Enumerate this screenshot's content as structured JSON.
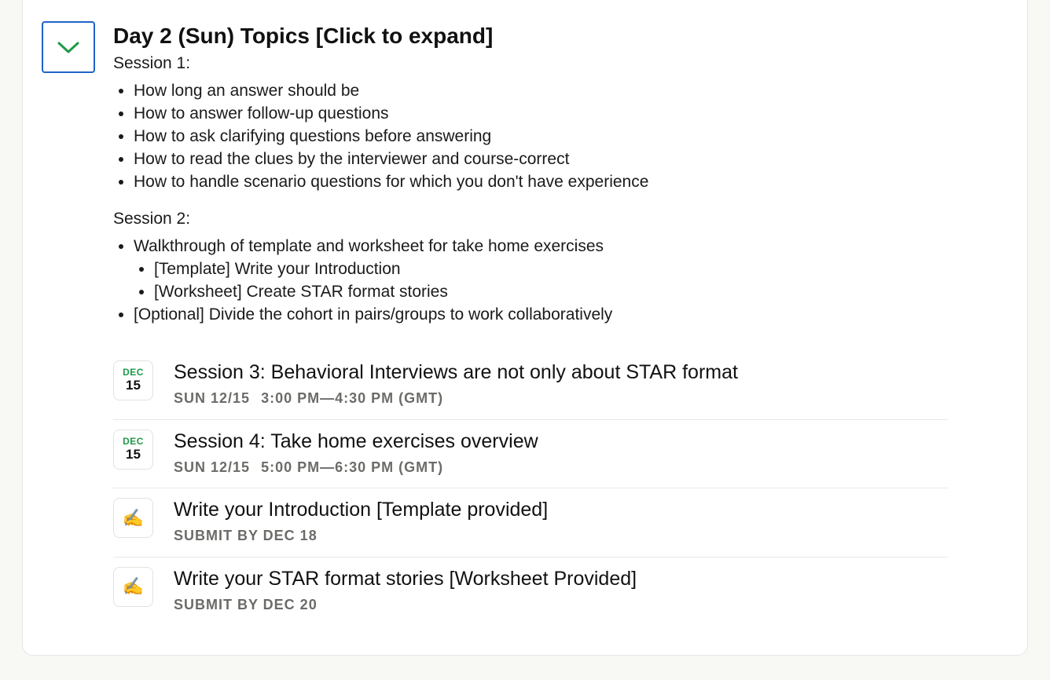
{
  "topic": {
    "title": "Day 2 (Sun) Topics [Click to expand]",
    "session1": {
      "label": "Session 1:",
      "items": [
        "How long an answer should be",
        "How to answer follow-up questions",
        "How to ask clarifying questions before answering",
        "How to read the clues by the interviewer and course-correct",
        "How to handle scenario questions for which you don't have experience"
      ]
    },
    "session2": {
      "label": "Session 2:",
      "items": [
        "Walkthrough of template and worksheet for take home exercises",
        "[Template] Write your Introduction",
        "[Worksheet] Create STAR format stories",
        "[Optional] Divide the cohort in pairs/groups to work collaboratively"
      ]
    }
  },
  "events": [
    {
      "month": "DEC",
      "day": "15",
      "title": "Session 3: Behavioral Interviews are not only about STAR format",
      "date": "SUN 12/15",
      "time": "3:00 PM—4:30 PM (GMT)"
    },
    {
      "month": "DEC",
      "day": "15",
      "title": "Session 4: Take home exercises overview",
      "date": "SUN 12/15",
      "time": "5:00 PM—6:30 PM (GMT)"
    },
    {
      "glyph": "✍️",
      "icon": "writing-hand-icon",
      "title": "Write your Introduction [Template provided]",
      "due": "SUBMIT BY DEC 18"
    },
    {
      "glyph": "✍️",
      "icon": "writing-hand-icon",
      "title": "Write your STAR format stories [Worksheet Provided]",
      "due": "SUBMIT BY DEC 20"
    }
  ],
  "colors": {
    "accent_blue": "#1f63c9",
    "accent_green": "#1f9a48",
    "muted_text": "#6b6b68"
  }
}
